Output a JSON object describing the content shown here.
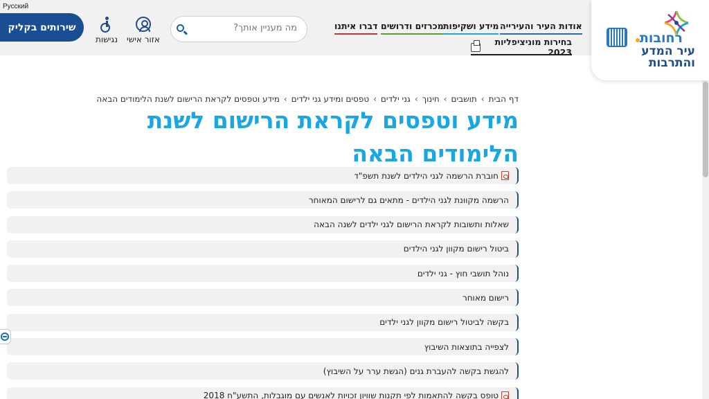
{
  "header": {
    "logo": {
      "city": "רחובות",
      "tagline_1": "עיר המדע",
      "tagline_2": "והתרבות"
    },
    "nav": [
      {
        "label": "אודות העיר והעירייה"
      },
      {
        "label": "מידע ושקיפות"
      },
      {
        "label": "מכרזים ודרושים"
      },
      {
        "label": "דברו איתנו"
      }
    ],
    "elections_label": "בחירות מוניציפליות 2023",
    "search": {
      "placeholder": "מה מעניין אותך?"
    },
    "personal_area": "אזור אישי",
    "accessibility": "נגישות",
    "services_button": "שירותים בקליק",
    "language_link": "Русский"
  },
  "breadcrumb": [
    "דף הבית",
    "תושבים",
    "חינוך",
    "גני ילדים",
    "טפסים ומידע גני ילדים",
    "מידע וטפסים לקראת הרישום לשנת הלימודים הבאה"
  ],
  "page_title": "מידע וטפסים לקראת הרישום לשנת הלימודים הבאה",
  "items": [
    {
      "label": "חוברת הרשמה לגני הילדים לשנת תשפ\"ד",
      "pdf": true
    },
    {
      "label": "הרשמה מקוונת לגני הילדים - מתאים גם לרישום המאוחר",
      "pdf": false
    },
    {
      "label": "שאלות ותשובות לקראת הרישום לגני ילדים לשנה הבאה",
      "pdf": false
    },
    {
      "label": "ביטול רישום מקוון לגני הילדים",
      "pdf": false
    },
    {
      "label": "נוהל תושבי חוץ - גני ילדים",
      "pdf": false
    },
    {
      "label": "רישום מאוחר",
      "pdf": false
    },
    {
      "label": "בקשה לביטול רישום מקוון לגני ילדים",
      "pdf": false
    },
    {
      "label": "לצפייה בתוצאות השיבוץ",
      "pdf": false
    },
    {
      "label": "להגשת בקשה להעברת גנים (הגשת ערר על השיבוץ)",
      "pdf": false
    },
    {
      "label": "טופס בקשה להתאמות לפי תקנות שוויון זכויות לאנשים עם מוגבלות, התשע\"ח 2018",
      "pdf": true
    }
  ],
  "colors": {
    "brand_blue": "#1a4e93",
    "title_cyan": "#1aa7e1",
    "pdf_red": "#d23a2c"
  }
}
